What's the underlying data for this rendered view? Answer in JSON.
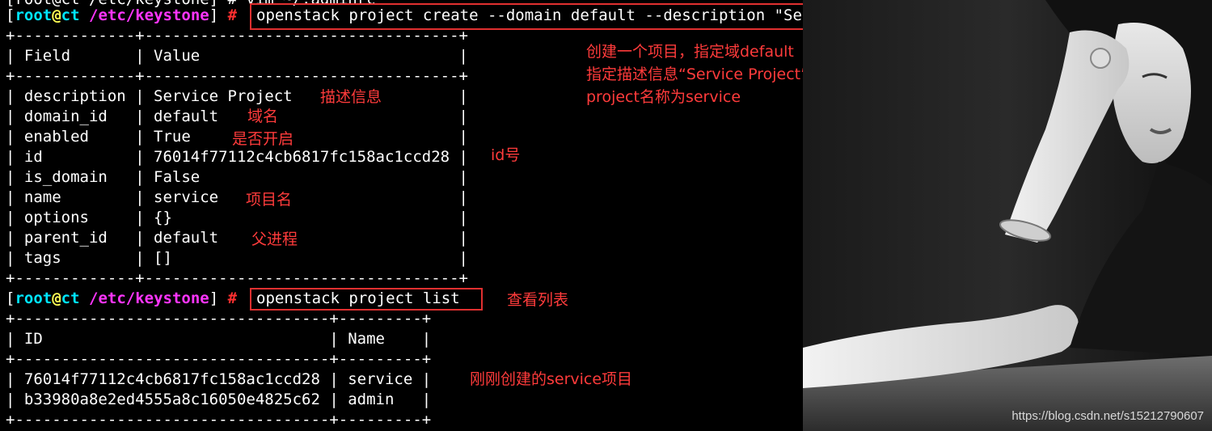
{
  "terminal": {
    "top_partial": "[root@ct /etc/keystone] # vim ~/.adminrc",
    "prompt1": {
      "open": "[",
      "user": "root",
      "at": "@",
      "host": "ct",
      "path": " /etc/keystone",
      "close": "] ",
      "hash": "#"
    },
    "command1": "openstack project create --domain default --description \"Service Project\" service",
    "table1": {
      "border": "+-------------+----------------------------------+",
      "header": "| Field       | Value                            |",
      "rows": [
        "| description | Service Project                  |",
        "| domain_id   | default                          |",
        "| enabled     | True                             |",
        "| id          | 76014f77112c4cb6817fc158ac1ccd28 |",
        "| is_domain   | False                            |",
        "| name        | service                          |",
        "| options     | {}                               |",
        "| parent_id   | default                          |",
        "| tags        | []                               |"
      ]
    },
    "prompt2": {
      "open": "[",
      "user": "root",
      "at": "@",
      "host": "ct",
      "path": " /etc/keystone",
      "close": "] ",
      "hash": "#"
    },
    "command2": "openstack project list",
    "table2": {
      "border": "+----------------------------------+---------+",
      "header": "| ID                               | Name    |",
      "rows": [
        "| 76014f77112c4cb6817fc158ac1ccd28 | service |",
        "| b33980a8e2ed4555a8c16050e4825c62 | admin   |"
      ]
    }
  },
  "annotations": {
    "create_note_line1": "创建一个项目，指定域default",
    "create_note_line2": "指定描述信息“Service Project”",
    "create_note_line3": "project名称为service",
    "description_note": "描述信息",
    "domain_note": "域名",
    "enabled_note": "是否开启",
    "id_note": "id号",
    "name_note": "项目名",
    "parent_note": "父进程",
    "list_note": "查看列表",
    "new_service_note": "刚刚创建的service项目"
  },
  "watermark": "https://blog.csdn.net/s15212790607",
  "colors": {
    "background": "#000000",
    "annotation": "#ff3b3b",
    "box": "#e03030",
    "prompt_path": "#ff35ff",
    "prompt_user": "#00e5ff"
  }
}
